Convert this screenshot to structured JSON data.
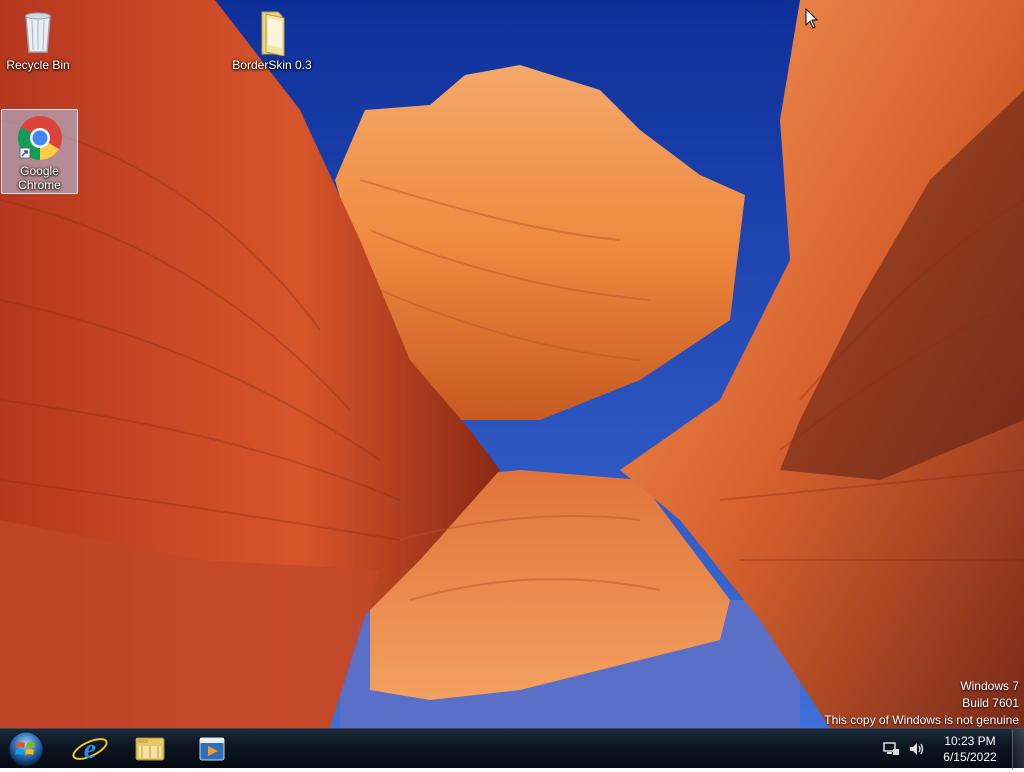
{
  "desktop": {
    "icons": [
      {
        "label": "Recycle Bin",
        "icon": "recycle-bin-icon"
      },
      {
        "label": "BorderSkin 0.3",
        "icon": "folder-icon"
      },
      {
        "label": "Google Chrome",
        "icon": "chrome-icon",
        "selected": true
      }
    ]
  },
  "watermark": {
    "line1": "Windows 7",
    "line2": "Build 7601",
    "line3": "This copy of Windows is not genuine"
  },
  "taskbar": {
    "start_icon": "windows-start-icon",
    "pinned": [
      {
        "name": "internet-explorer",
        "icon": "internet-explorer-icon"
      },
      {
        "name": "windows-explorer",
        "icon": "file-explorer-icon"
      },
      {
        "name": "media-player",
        "icon": "media-player-icon"
      }
    ],
    "tray": {
      "icons": [
        "network-icon",
        "volume-icon"
      ],
      "time": "10:23 PM",
      "date": "6/15/2022"
    }
  },
  "colors": {
    "sky": "#1f4fc7",
    "rock_orange": "#e07a3c",
    "rock_dark": "#7a1f10",
    "taskbar": "#0c1520"
  }
}
